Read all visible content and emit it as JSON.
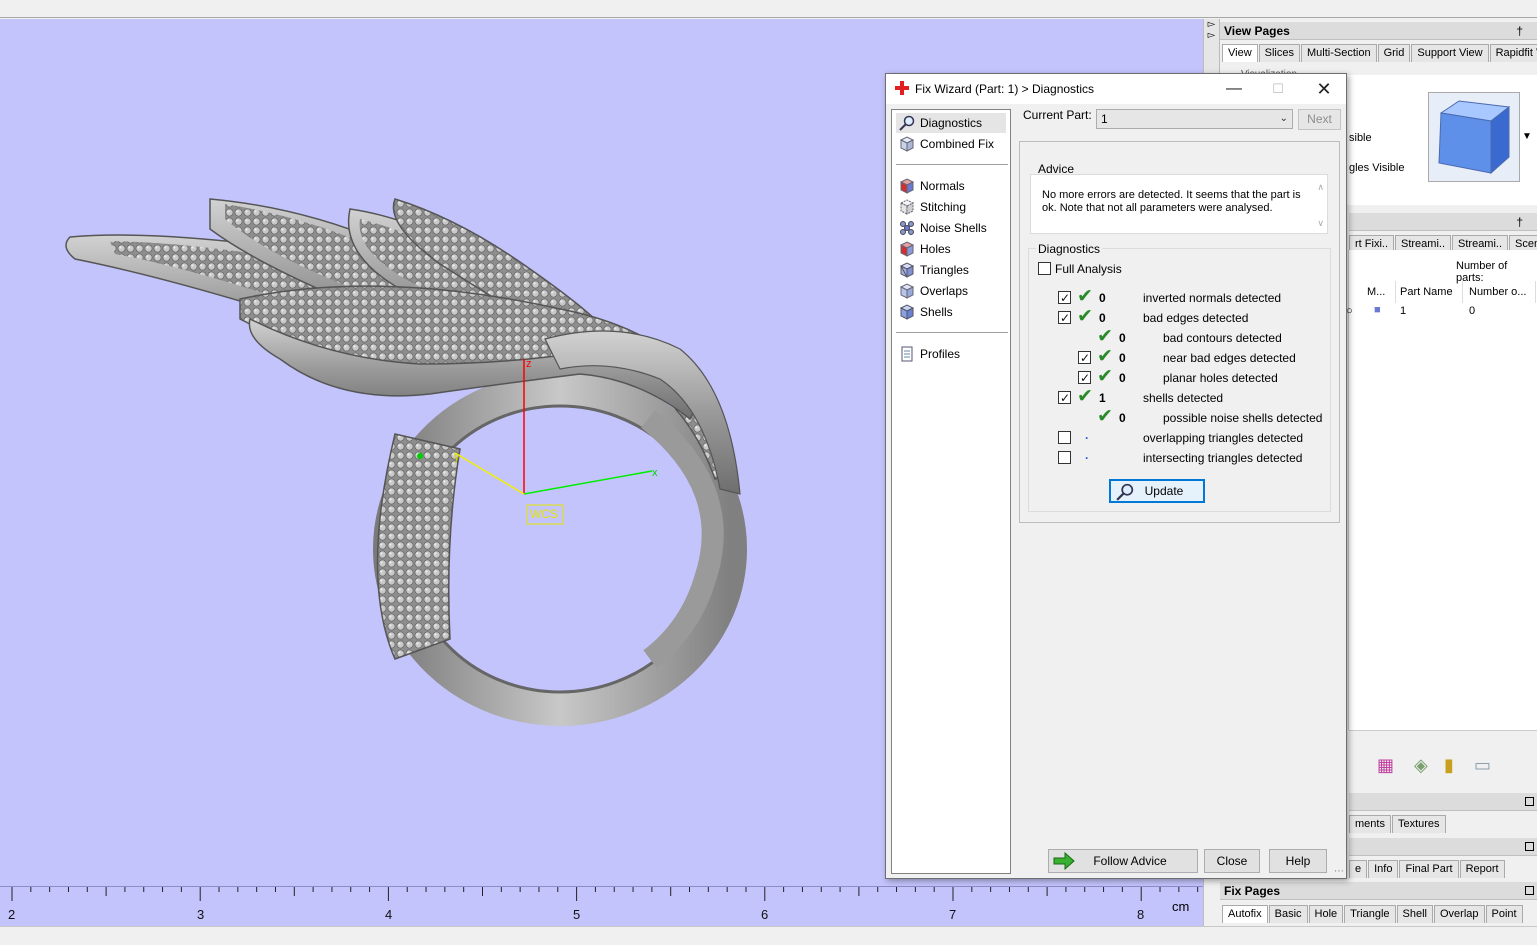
{
  "ruler": {
    "labels": [
      "2",
      "3",
      "4",
      "5",
      "6",
      "7",
      "8"
    ],
    "unit": "cm"
  },
  "viewport": {
    "axis_z": "z",
    "axis_x": "x",
    "axis_y": "y",
    "wcs_label": "WCS",
    "background_color": "#c4c4fd"
  },
  "right_panel": {
    "view_pages": {
      "title": "View Pages",
      "tabs": [
        "View",
        "Slices",
        "Multi-Section",
        "Grid",
        "Support View",
        "Rapidfit View"
      ],
      "text_visualization": "Visualization",
      "text_visible": "sible",
      "text_triangles_visible": "gles Visible"
    },
    "parts": {
      "tabs": [
        "rt Fixi..",
        "Streami..",
        "Streami..",
        "Scenes"
      ],
      "number_of_parts_label": "Number of parts:",
      "columns": [
        "M...",
        "Part Name",
        "Number o..."
      ],
      "row": {
        "name": "1",
        "number": "0"
      }
    },
    "lower_tabs": [
      "ments",
      "Textures"
    ],
    "info_tabs": [
      "e",
      "Info",
      "Final Part",
      "Report"
    ],
    "fix_pages": {
      "title": "Fix Pages",
      "tabs": [
        "Autofix",
        "Basic",
        "Hole",
        "Triangle",
        "Shell",
        "Overlap",
        "Point"
      ]
    }
  },
  "dialog": {
    "title": "Fix Wizard (Part: 1) > Diagnostics",
    "nav_items": [
      {
        "label": "Diagnostics",
        "icon": "magnifier-icon"
      },
      {
        "label": "Combined Fix",
        "icon": "cube-icon"
      },
      {
        "label": "Normals",
        "icon": "normals-cube-icon"
      },
      {
        "label": "Stitching",
        "icon": "stitching-cube-icon"
      },
      {
        "label": "Noise Shells",
        "icon": "noise-shells-icon"
      },
      {
        "label": "Holes",
        "icon": "holes-cube-icon"
      },
      {
        "label": "Triangles",
        "icon": "triangles-cube-icon"
      },
      {
        "label": "Overlaps",
        "icon": "overlaps-cube-icon"
      },
      {
        "label": "Shells",
        "icon": "shells-cube-icon"
      },
      {
        "label": "Profiles",
        "icon": "document-icon"
      }
    ],
    "current_part_label": "Current Part:",
    "current_part_value": "1",
    "next_label": "Next",
    "advice": {
      "title": "Advice",
      "text": "No more errors are detected. It seems that the part is ok. Note that not all parameters were analysed."
    },
    "diagnostics": {
      "title": "Diagnostics",
      "full_analysis_label": "Full Analysis",
      "full_analysis_checked": false,
      "rows": [
        {
          "checkbox": true,
          "checked": true,
          "status": "ok",
          "count": "0",
          "label": "inverted normals detected",
          "indent": 0
        },
        {
          "checkbox": true,
          "checked": true,
          "status": "ok",
          "count": "0",
          "label": "bad edges detected",
          "indent": 0
        },
        {
          "checkbox": false,
          "checked": false,
          "status": "ok",
          "count": "0",
          "label": "bad contours detected",
          "indent": 1
        },
        {
          "checkbox": true,
          "checked": true,
          "status": "ok",
          "count": "0",
          "label": "near bad edges detected",
          "indent": 1
        },
        {
          "checkbox": true,
          "checked": true,
          "status": "ok",
          "count": "0",
          "label": "planar holes detected",
          "indent": 1
        },
        {
          "checkbox": true,
          "checked": true,
          "status": "ok",
          "count": "1",
          "label": "shells detected",
          "indent": 0
        },
        {
          "checkbox": false,
          "checked": false,
          "status": "ok",
          "count": "0",
          "label": "possible noise shells detected",
          "indent": 1
        },
        {
          "checkbox": true,
          "checked": false,
          "status": "none",
          "count": "",
          "label": "overlapping triangles detected",
          "indent": 0
        },
        {
          "checkbox": true,
          "checked": false,
          "status": "none",
          "count": "",
          "label": "intersecting triangles detected",
          "indent": 0
        }
      ],
      "update_label": "Update"
    },
    "follow_advice_label": "Follow Advice",
    "close_label": "Close",
    "help_label": "Help"
  }
}
